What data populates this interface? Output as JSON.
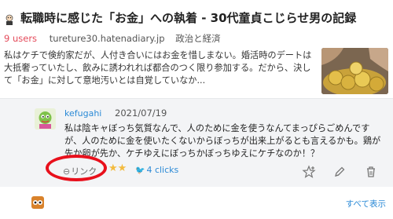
{
  "entry": {
    "title": "転職時に感じた「お金」への執着 - 30代童貞こじらせ男の記録",
    "users": "9 users",
    "domain": "tureture30.hatenadiary.jp",
    "category": "政治と経済",
    "summary": "私はケチで倹約家だが、人付き合いにはお金を惜しまない。婚活時のデートは大抵奢っていたし、飲みに誘われれば都合のつく限り参加する。だから、決して「お金」に対して意地汚いとは自覚していなか...",
    "thumbnail_icon": "coins-image"
  },
  "comment": {
    "user": "kefugahi",
    "date": "2021/07/19",
    "text": "私は陰キャぼっち気質なんで、人のために金を使うなんてまっぴらごめんですが、人のために金を使いたくないからぼっちが出来上がるとも言えるかも。鶏が先か卵が先か、ケチゆえにぼっちかぼっちゆえにケチなのか！？",
    "link_label": "リンク",
    "stars": "★★",
    "clicks_label": "4 clicks",
    "accent": "#2b8ad6"
  },
  "footer": {
    "show_all": "すべて表示"
  },
  "annotation": {
    "color": "#e8101c"
  }
}
